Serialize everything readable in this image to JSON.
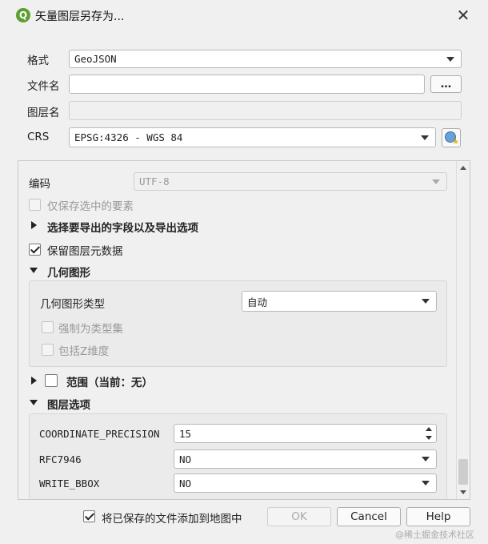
{
  "window": {
    "title": "矢量图层另存为...",
    "close_glyph": "✕",
    "icon_letter": "Q"
  },
  "fields": {
    "format_label": "格式",
    "format_value": "GeoJSON",
    "filename_label": "文件名",
    "filename_value": "",
    "browse_label": "…",
    "layername_label": "图层名",
    "layername_value": "",
    "crs_label": "CRS",
    "crs_value": "EPSG:4326 - WGS 84"
  },
  "options": {
    "encoding_label": "编码",
    "encoding_value": "UTF-8",
    "selected_only_label": "仅保存选中的要素",
    "fields_section_label": "选择要导出的字段以及导出选项",
    "keep_metadata_label": "保留图层元数据",
    "geometry_section_label": "几何图形",
    "geometry_type_label": "几何图形类型",
    "geometry_type_value": "自动",
    "force_multi_label": "强制为类型集",
    "include_z_label": "包括Z维度",
    "extent_label": "范围（当前：无）",
    "layer_options_label": "图层选项",
    "coord_precision_label": "COORDINATE_PRECISION",
    "coord_precision_value": "15",
    "rfc7946_label": "RFC7946",
    "rfc7946_value": "NO",
    "write_bbox_label": "WRITE_BBOX",
    "write_bbox_value": "NO"
  },
  "footer": {
    "add_to_map_label": "将已保存的文件添加到地图中",
    "ok_label": "OK",
    "cancel_label": "Cancel",
    "help_label": "Help"
  },
  "watermark": "@稀土掘金技术社区",
  "colors": {
    "qgis_green": "#5c9e31",
    "globe_blue": "#6aa0d8"
  },
  "icons": [
    "qgis-logo-icon",
    "close-icon",
    "crs-globe-icon"
  ]
}
